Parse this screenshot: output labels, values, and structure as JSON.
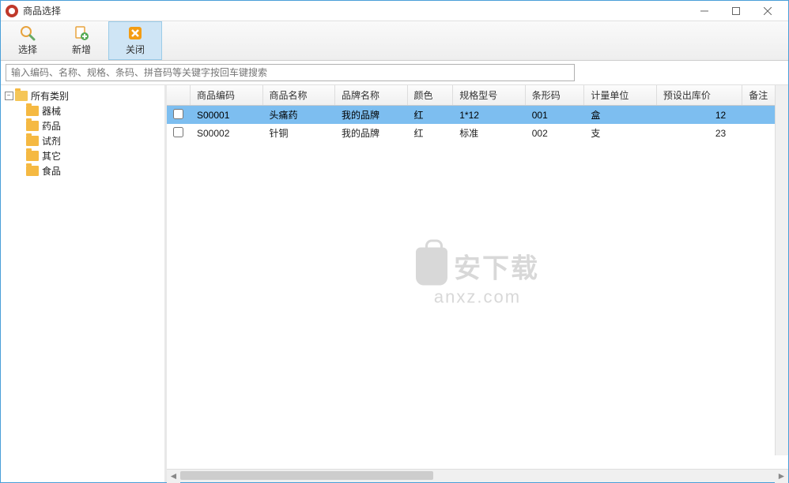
{
  "window": {
    "title": "商品选择"
  },
  "toolbar": {
    "select_label": "选择",
    "new_label": "新增",
    "close_label": "关闭"
  },
  "search": {
    "placeholder": "输入编码、名称、规格、条码、拼音码等关键字按回车键搜索"
  },
  "tree": {
    "root": "所有类别",
    "items": [
      "器械",
      "药品",
      "试剂",
      "其它",
      "食品"
    ]
  },
  "table": {
    "headers": [
      "商品编码",
      "商品名称",
      "品牌名称",
      "颜色",
      "规格型号",
      "条形码",
      "计量单位",
      "预设出库价",
      "备注"
    ],
    "rows": [
      {
        "selected": true,
        "code": "S00001",
        "name": "头痛药",
        "brand": "我的品牌",
        "color": "红",
        "spec": "1*12",
        "barcode": "001",
        "unit": "盒",
        "price": "12"
      },
      {
        "selected": false,
        "code": "S00002",
        "name": "针铜",
        "brand": "我的品牌",
        "color": "红",
        "spec": "标准",
        "barcode": "002",
        "unit": "支",
        "price": "23"
      }
    ]
  },
  "watermark": {
    "text": "安下载",
    "url": "anxz.com"
  }
}
